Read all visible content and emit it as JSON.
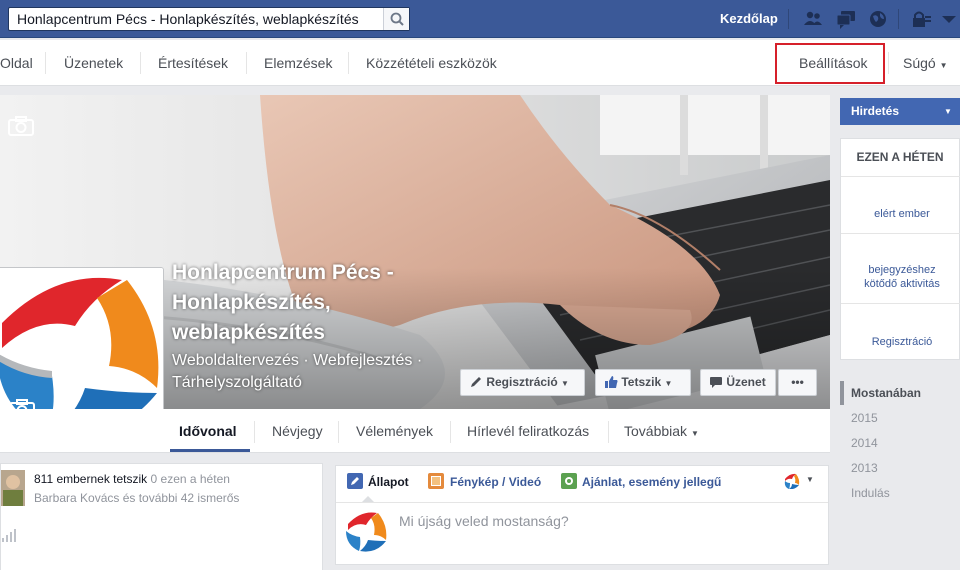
{
  "search": {
    "value": "Honlapcentrum Pécs - Honlapkészítés, weblapkészítés",
    "placeholder": ""
  },
  "topnav": {
    "home_label": "Kezdőlap"
  },
  "admin_menu": {
    "items": [
      "Oldal",
      "Üzenetek",
      "Értesítések",
      "Elemzések",
      "Közzétételi eszközök"
    ],
    "settings_label": "Beállítások",
    "help_label": "Súgó",
    "highlight_color": "#d6202a"
  },
  "page": {
    "name": "Honlapcentrum Pécs - Honlapkészítés, weblapkészítés",
    "category": "Weboldaltervezés · Webfejlesztés · Tárhelyszolgáltató"
  },
  "cover_buttons": {
    "register": "Regisztráció",
    "like": "Tetszik",
    "message": "Üzenet",
    "more": "•••"
  },
  "tabs": [
    "Idővonal",
    "Névjegy",
    "Vélemények",
    "Hírlevél feliratkozás",
    "Továbbiak"
  ],
  "stats": {
    "likes": "811 embernek tetszik",
    "likes_week": "0 ezen a héten",
    "friends": "Barbara Kovács és további 42 ismerős"
  },
  "composer": {
    "tabs": [
      "Állapot",
      "Fénykép / Videó",
      "Ajánlat, esemény jellegű"
    ],
    "placeholder": "Mi újság veled mostanság?"
  },
  "sidebar": {
    "ad_label": "Hirdetés",
    "week_title": "EZEN A HÉTEN",
    "reached": "elért ember",
    "activity": "bejegyzéshez kötődő aktivitás",
    "register": "Regisztráció"
  },
  "timeline": [
    "Mostanában",
    "2015",
    "2014",
    "2013",
    "Indulás"
  ],
  "colors": {
    "facebook_blue": "#3b5998",
    "ad_blue": "#4267b2",
    "logo_red": "#e0262c",
    "logo_orange": "#f08a1c",
    "logo_blue": "#1f6fb8"
  }
}
